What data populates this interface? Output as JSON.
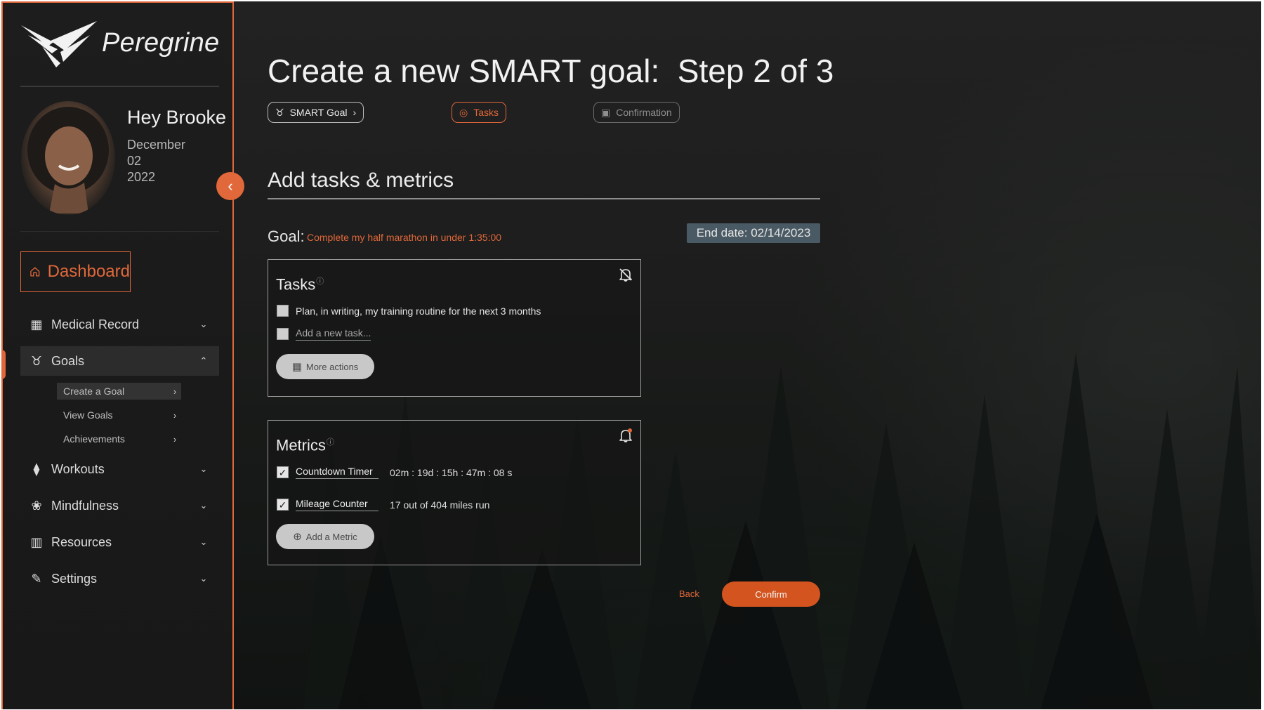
{
  "brand": {
    "name": "Peregrine"
  },
  "user": {
    "greeting": "Hey Brooke",
    "date_month": "December",
    "date_day": "02",
    "date_year": "2022"
  },
  "sidebar": {
    "dashboard": "Dashboard",
    "items": [
      {
        "label": "Medical Record",
        "icon": "layout-icon"
      },
      {
        "label": "Goals",
        "icon": "award-icon"
      },
      {
        "label": "Workouts",
        "icon": "dumbbell-icon"
      },
      {
        "label": "Mindfulness",
        "icon": "lotus-icon"
      },
      {
        "label": "Resources",
        "icon": "book-icon"
      },
      {
        "label": "Settings",
        "icon": "wrench-icon"
      }
    ],
    "goals_sub": [
      "Create a Goal",
      "View Goals",
      "Achievements"
    ]
  },
  "page": {
    "title": "Create a new SMART goal:  Step 2 of 3"
  },
  "steps": [
    "SMART Goal",
    "Tasks",
    "Confirmation"
  ],
  "section": {
    "title": "Add tasks & metrics"
  },
  "goal": {
    "label": "Goal:",
    "text": "Complete my half marathon in under 1:35:00",
    "end_date": "End date: 02/14/2023"
  },
  "tasks": {
    "title": "Tasks",
    "items": [
      {
        "label": "Plan, in writing, my training routine for the next 3 months",
        "checked": false
      }
    ],
    "new_placeholder": "Add a new task...",
    "more_actions": "More actions"
  },
  "metrics": {
    "title": "Metrics",
    "items": [
      {
        "name": "Countdown Timer",
        "value": "02m : 19d : 15h : 47m : 08 s",
        "checked": true
      },
      {
        "name": "Mileage Counter",
        "value": "17 out of 404 miles run",
        "checked": true
      }
    ],
    "add_label": "Add a Metric"
  },
  "actions": {
    "back": "Back",
    "confirm": "Confirm"
  },
  "colors": {
    "accent": "#e1683a",
    "confirm": "#d3541f",
    "end_date_bg": "#4a5a64"
  }
}
